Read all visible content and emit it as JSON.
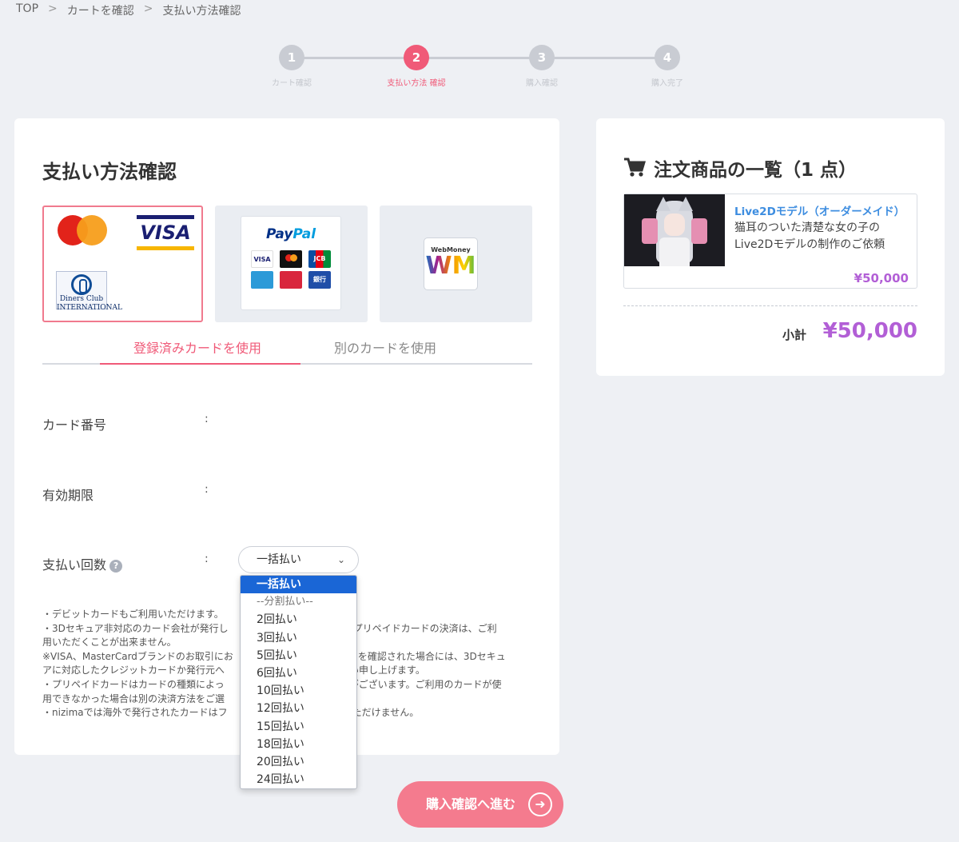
{
  "breadcrumb": {
    "items": [
      "TOP",
      "カートを確認",
      "支払い方法確認"
    ],
    "separator": ">"
  },
  "stepper": {
    "steps": [
      {
        "number": "1",
        "label": "カート確認"
      },
      {
        "number": "2",
        "label": "支払い方法 確認"
      },
      {
        "number": "3",
        "label": "購入確認"
      },
      {
        "number": "4",
        "label": "購入完了"
      }
    ],
    "active_step": 2
  },
  "main": {
    "title": "支払い方法確認",
    "payment_logos": {
      "card": {
        "visa": "VISA",
        "diners": "Diners Club INTERNATIONAL"
      },
      "paypal": {
        "brand_pay": "Pay",
        "brand_pal": "Pal",
        "sub": [
          "VISA",
          "",
          "JCB",
          "",
          "",
          "銀行"
        ]
      },
      "webmoney": {
        "name": "WebMoney",
        "mark": "WM"
      }
    },
    "tabs": [
      {
        "label": "登録済みカードを使用"
      },
      {
        "label": "別のカードを使用"
      }
    ],
    "fields": {
      "card_number": {
        "label": "カード番号",
        "colon": ":"
      },
      "expiry": {
        "label": "有効期限",
        "colon": ":"
      },
      "installments": {
        "label": "支払い回数",
        "help": "?",
        "colon": ":"
      }
    },
    "installment_select": {
      "value": "一括払い"
    },
    "notes": [
      "・デビットカードもご利用いただけます。",
      "・3Dセキュア非対応のカード会社が発行し",
      "びプリペイドカードの決済は、ご利",
      "用いただくことが出来ません。",
      "※VISA、MasterCardブランドのお取引にお",
      "ーを確認された場合には、3Dセキュ",
      "アに対応したクレジットカードか発行元へ",
      "願い申し上げます。",
      "・プリペイドカードはカードの種類によっ",
      "合がございます。ご利用のカードが使",
      "用できなかった場合は別の決済方法をご選",
      "・nizimaでは海外で発行されたカードはフ",
      "いただけません。"
    ]
  },
  "dropdown": {
    "options": [
      "一括払い",
      "--分割払い--",
      "2回払い",
      "3回払い",
      "5回払い",
      "6回払い",
      "10回払い",
      "12回払い",
      "15回払い",
      "18回払い",
      "20回払い",
      "24回払い"
    ],
    "selected_index": 0
  },
  "side": {
    "title": "注文商品の一覧（1 点）",
    "product": {
      "name": "Live2Dモデル（オーダーメイド）",
      "description": "猫耳のついた清楚な女の子のLive2Dモデルの制作のご依頼",
      "price": "¥50,000"
    },
    "subtotal_label": "小計",
    "subtotal_value": "¥50,000"
  },
  "proceed_button": {
    "label": "購入確認へ進む",
    "icon": "arrow-right-circle-icon"
  },
  "colors": {
    "accent": "#f05a78",
    "price": "#b25fd6",
    "link": "#3d8de0",
    "select_highlight": "#1a66d6"
  }
}
